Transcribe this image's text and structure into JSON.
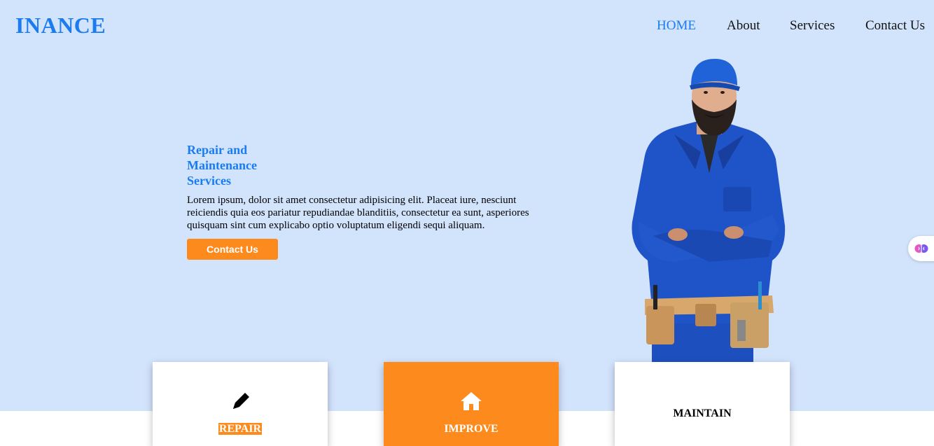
{
  "brand": {
    "logo": "INANCE"
  },
  "nav": {
    "items": [
      {
        "label": "HOME",
        "active": true
      },
      {
        "label": "About",
        "active": false
      },
      {
        "label": "Services",
        "active": false
      },
      {
        "label": "Contact Us",
        "active": false
      }
    ]
  },
  "hero": {
    "title": "Repair and Maintenance Services",
    "description": "Lorem ipsum, dolor sit amet consectetur adipisicing elit. Placeat iure, nesciunt reiciendis quia eos pariatur repudiandae blanditiis, consectetur ea sunt, asperiores quisquam sint cum explicabo optio voluptatum eligendi sequi aliquam.",
    "cta_label": "Contact Us"
  },
  "services": [
    {
      "label": "REPAIR",
      "icon": "pencil-icon"
    },
    {
      "label": "IMPROVE",
      "icon": "home-icon"
    },
    {
      "label": "MAINTAIN",
      "icon": ""
    }
  ],
  "colors": {
    "accent": "#1a7cf0",
    "hero_bg": "#d2e3fc",
    "orange": "#fd8a1d"
  }
}
